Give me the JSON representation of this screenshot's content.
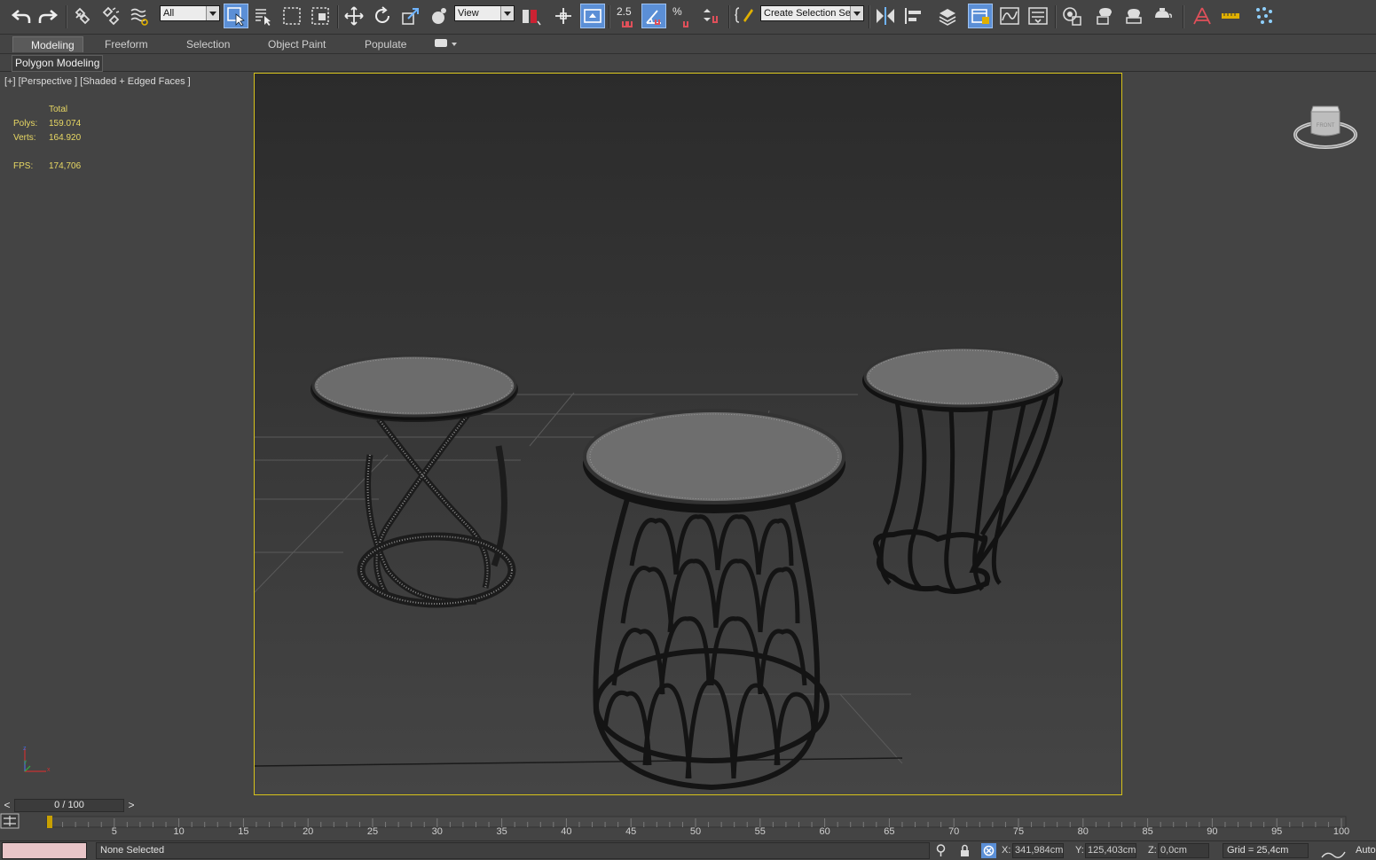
{
  "toolbar": {
    "selection_filter": "All",
    "reference_coord": "View",
    "angle_snap_label": "2.5",
    "percent_snap_label": "%",
    "named_selection": "Create Selection Se",
    "icons": [
      "undo-icon",
      "redo-icon",
      "link-icon",
      "unlink-icon",
      "bind-space-warp-icon",
      "select-object-icon",
      "select-by-name-icon",
      "rect-region-icon",
      "window-crossing-icon",
      "move-icon",
      "rotate-icon",
      "scale-icon",
      "place-icon",
      "pivot-center-icon",
      "manipulate-icon",
      "snap-toggle-icon",
      "angle-snap-icon",
      "percent-snap-icon",
      "spinner-snap-icon",
      "edit-named-selection-icon",
      "mirror-icon",
      "align-icon",
      "layer-manager-icon",
      "scene-explorer-icon",
      "curve-editor-icon",
      "schematic-view-icon",
      "material-editor-icon",
      "render-setup-icon",
      "render-frame-icon",
      "render-icon",
      "render-iterative-icon",
      "civil-view-icon",
      "measure-icon",
      "particle-icon"
    ],
    "active_color": "#5b8fd6"
  },
  "ribbon": {
    "tabs": [
      "Modeling",
      "Freeform",
      "Selection",
      "Object Paint",
      "Populate"
    ],
    "active_tab": "Modeling",
    "sub_panel": "Polygon Modeling"
  },
  "viewport": {
    "label": "[+] [Perspective ] [Shaded + Edged Faces ]",
    "stats": {
      "header": "Total",
      "polys_label": "Polys:",
      "polys": "159.074",
      "verts_label": "Verts:",
      "verts": "164.920",
      "fps_label": "FPS:",
      "fps": "174,706"
    },
    "viewcube_label": "FRONT",
    "border_color": "#d6c21a",
    "stats_color": "#e8d864"
  },
  "timeline": {
    "frame_display": "0 / 100",
    "prev_label": "<",
    "next_label": ">",
    "ticks": [
      "5",
      "10",
      "15",
      "20",
      "25",
      "30",
      "35",
      "40",
      "45",
      "50",
      "55",
      "60",
      "65",
      "70",
      "75",
      "80",
      "85",
      "90",
      "95",
      "100"
    ]
  },
  "status": {
    "selection_text": "None Selected",
    "x_label": "X:",
    "x_value": "341,984cm",
    "y_label": "Y:",
    "y_value": "125,403cm",
    "z_label": "Z:",
    "z_value": "0,0cm",
    "grid_text": "Grid = 25,4cm",
    "auto_label": "Auto"
  }
}
